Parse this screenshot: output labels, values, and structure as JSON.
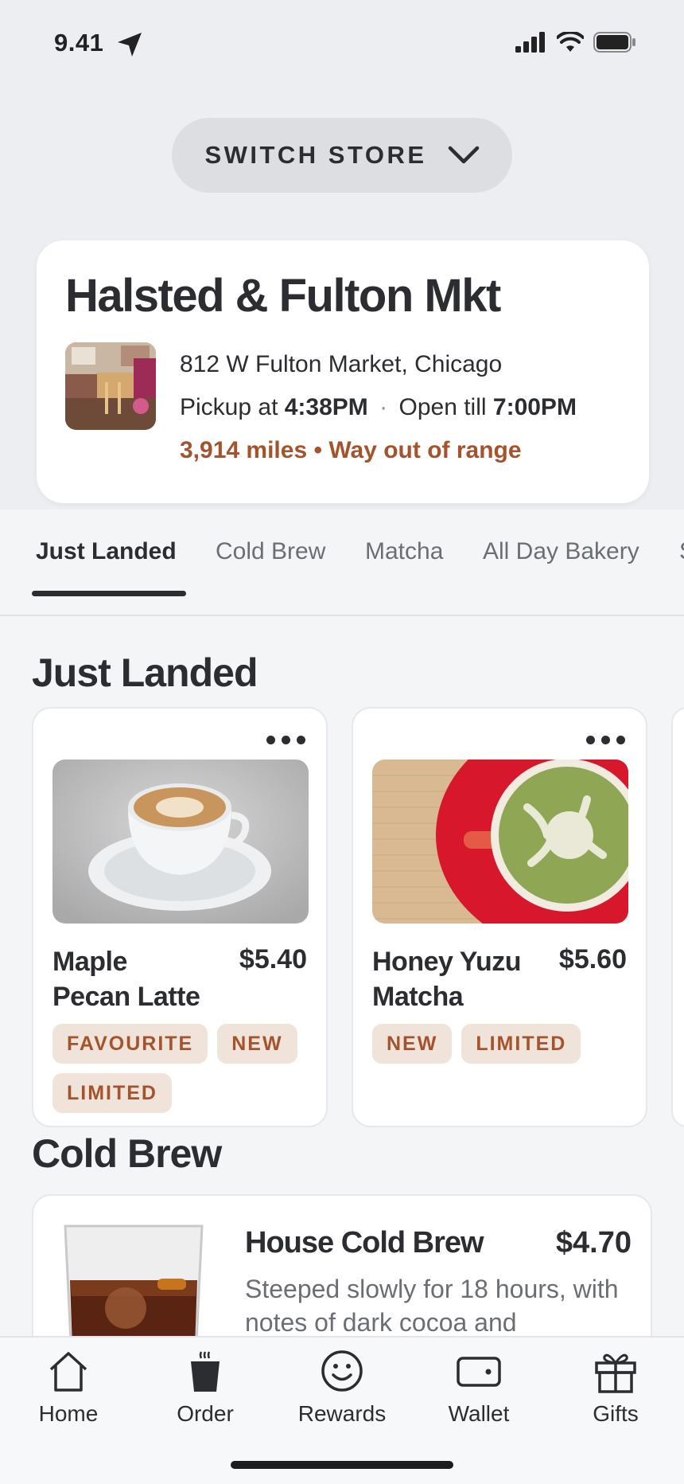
{
  "status_bar": {
    "time": "9.41"
  },
  "switch_store": {
    "label": "SWITCH STORE"
  },
  "store": {
    "name": "Halsted & Fulton Mkt",
    "address": "812 W Fulton Market, Chicago",
    "pickup_prefix": "Pickup at",
    "pickup_time": "4:38PM",
    "open_prefix": "Open till",
    "open_time": "7:00PM",
    "distance": "3,914 miles",
    "range_status": "Way out of range"
  },
  "category_tabs": [
    {
      "label": "Just Landed",
      "active": true
    },
    {
      "label": "Cold Brew"
    },
    {
      "label": "Matcha"
    },
    {
      "label": "All Day Bakery"
    },
    {
      "label": "S"
    }
  ],
  "sections": {
    "just_landed": {
      "title": "Just Landed",
      "products": [
        {
          "name": "Maple Pecan Latte",
          "price": "$5.40",
          "badges": [
            "FAVOURITE",
            "NEW",
            "LIMITED"
          ]
        },
        {
          "name": "Honey Yuzu Matcha",
          "price": "$5.60",
          "badges": [
            "NEW",
            "LIMITED"
          ]
        }
      ]
    },
    "cold_brew": {
      "title": "Cold Brew",
      "products": [
        {
          "name": "House Cold Brew",
          "price": "$4.70",
          "description": "Steeped slowly for 18 hours, with notes of dark cocoa and"
        }
      ]
    }
  },
  "tab_bar": [
    {
      "label": "Home",
      "icon": "home-icon"
    },
    {
      "label": "Order",
      "icon": "cup-icon"
    },
    {
      "label": "Rewards",
      "icon": "smiley-icon"
    },
    {
      "label": "Wallet",
      "icon": "wallet-icon"
    },
    {
      "label": "Gifts",
      "icon": "gift-icon"
    }
  ],
  "colors": {
    "accent": "#a4532d",
    "badge_bg": "#f0e3da",
    "text": "#2b2d30"
  }
}
